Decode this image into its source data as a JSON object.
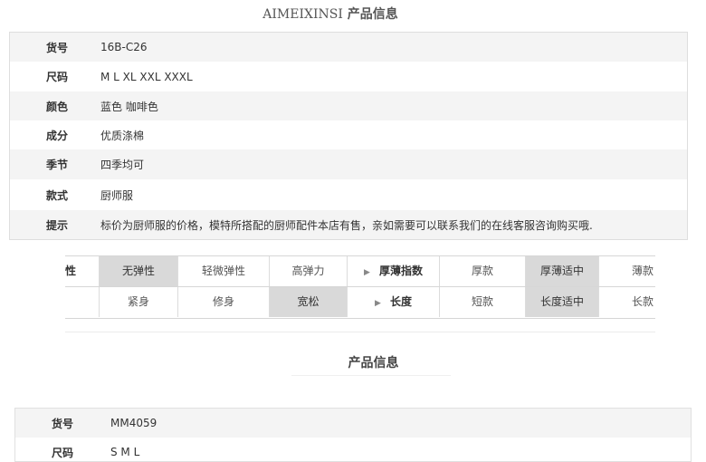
{
  "section1": {
    "brand": "AIMEIXINSI",
    "title": "产品信息",
    "rows": [
      {
        "label": "货号",
        "value": "16B-C26"
      },
      {
        "label": "尺码",
        "value": "M L XL XXL XXXL"
      },
      {
        "label": "颜色",
        "value": "蓝色  咖啡色"
      },
      {
        "label": "成分",
        "value": "优质涤棉"
      },
      {
        "label": "季节",
        "value": "四季均可"
      },
      {
        "label": "款式",
        "value": "厨师服"
      },
      {
        "label": "提示",
        "value": "标价为厨师服的价格，模特所搭配的厨师配件本店有售，亲如需要可以联系我们的在线客服咨询购买哦."
      }
    ]
  },
  "scale_table": {
    "row1": {
      "elastic_label": "性",
      "elastic_options": [
        "无弹性",
        "轻微弹性",
        "高弹力"
      ],
      "elastic_selected": "无弹性",
      "thickness_label": "厚薄指数",
      "thickness_options": [
        "厚款",
        "厚薄适中",
        "薄款"
      ],
      "thickness_selected": "厚薄适中"
    },
    "row2": {
      "fit_options": [
        "紧身",
        "修身",
        "宽松"
      ],
      "fit_selected": "宽松",
      "length_label": "长度",
      "length_options": [
        "短款",
        "长度适中",
        "长款"
      ],
      "length_selected": "长度适中"
    }
  },
  "section2": {
    "title": "产品信息",
    "rows": [
      {
        "label": "货号",
        "value": "MM4059"
      },
      {
        "label": "尺码",
        "value": "S M L"
      }
    ]
  }
}
